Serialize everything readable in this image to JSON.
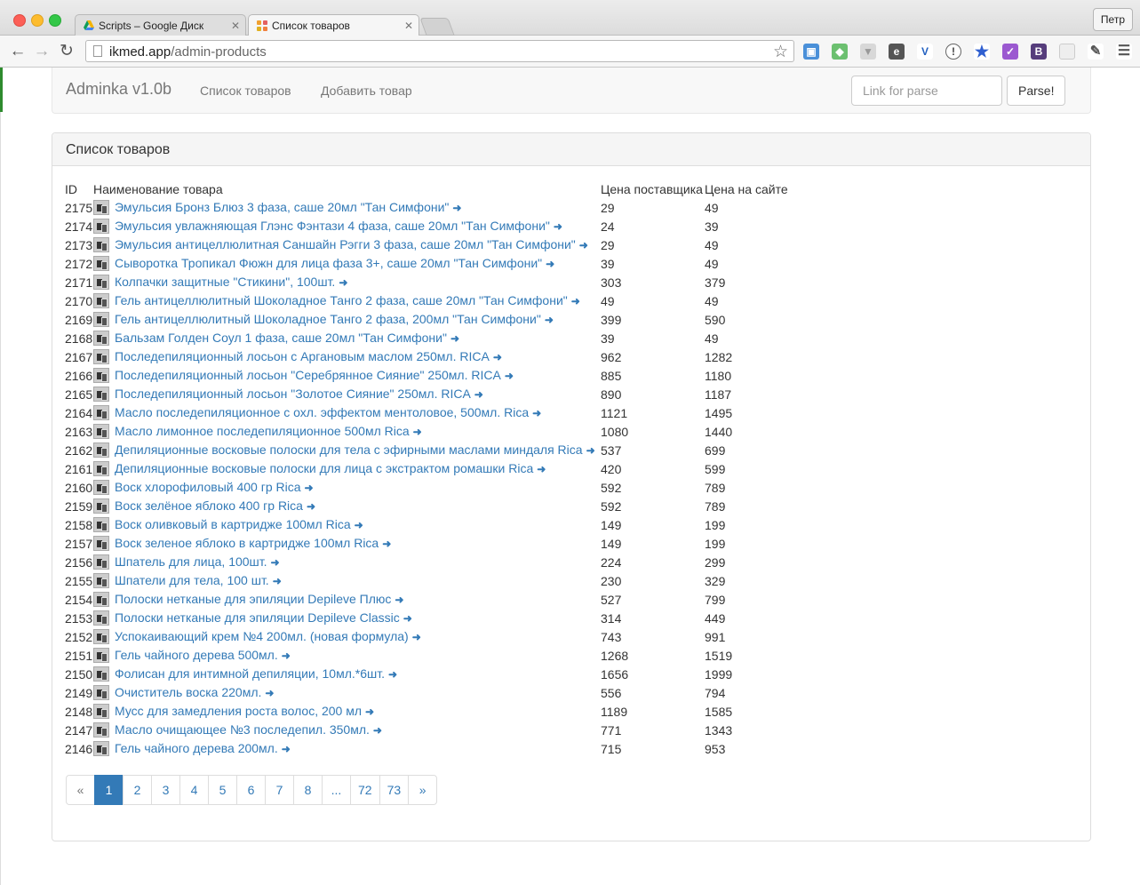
{
  "browser": {
    "tabs": [
      {
        "title": "Scripts – Google Диск"
      },
      {
        "title": "Список товаров"
      }
    ],
    "user_button": "Петр",
    "url_host": "ikmed.app",
    "url_path": "/admin-products"
  },
  "navbar": {
    "brand": "Adminka v1.0b",
    "links": [
      "Список товаров",
      "Добавить товар"
    ],
    "parse_placeholder": "Link for parse",
    "parse_button": "Parse!"
  },
  "panel": {
    "heading": "Список товаров",
    "columns": [
      "ID",
      "Наименование товара",
      "Цена поставщика",
      "Цена на сайте"
    ],
    "rows": [
      {
        "id": "2175",
        "name": "Эмульсия Бронз Блюз 3 фаза, саше 20мл \"Тан Симфони\"",
        "supplier_price": "29",
        "site_price": "49"
      },
      {
        "id": "2174",
        "name": "Эмульсия увлажняющая Глэнс Фэнтази 4 фаза, саше 20мл \"Тан Симфони\"",
        "supplier_price": "24",
        "site_price": "39"
      },
      {
        "id": "2173",
        "name": "Эмульсия антицеллюлитная Саншайн Рэгги 3 фаза, саше 20мл \"Тан Симфони\"",
        "supplier_price": "29",
        "site_price": "49"
      },
      {
        "id": "2172",
        "name": "Сыворотка Тропикал Фюжн для лица фаза 3+, саше 20мл \"Тан Симфони\"",
        "supplier_price": "39",
        "site_price": "49"
      },
      {
        "id": "2171",
        "name": "Колпачки защитные \"Стикини\", 100шт.",
        "supplier_price": "303",
        "site_price": "379"
      },
      {
        "id": "2170",
        "name": "Гель антицеллюлитный Шоколадное Танго 2 фаза, саше 20мл \"Тан Симфони\"",
        "supplier_price": "49",
        "site_price": "49"
      },
      {
        "id": "2169",
        "name": "Гель антицеллюлитный Шоколадное Танго 2 фаза, 200мл \"Тан Симфони\"",
        "supplier_price": "399",
        "site_price": "590"
      },
      {
        "id": "2168",
        "name": "Бальзам Голден Соул 1 фаза, саше 20мл \"Тан Симфони\"",
        "supplier_price": "39",
        "site_price": "49"
      },
      {
        "id": "2167",
        "name": "Последепиляционный лосьон с Аргановым маслом 250мл. RICA",
        "supplier_price": "962",
        "site_price": "1282"
      },
      {
        "id": "2166",
        "name": "Последепиляционный лосьон \"Серебрянное Сияние\" 250мл. RICA",
        "supplier_price": "885",
        "site_price": "1180"
      },
      {
        "id": "2165",
        "name": "Последепиляционный лосьон \"Золотое Сияние\" 250мл. RICA",
        "supplier_price": "890",
        "site_price": "1187"
      },
      {
        "id": "2164",
        "name": "Масло последепиляционное с охл. эффектом ментоловое, 500мл. Rica",
        "supplier_price": "1121",
        "site_price": "1495"
      },
      {
        "id": "2163",
        "name": "Масло лимонное последепиляционное 500мл Rica",
        "supplier_price": "1080",
        "site_price": "1440"
      },
      {
        "id": "2162",
        "name": "Депиляционные восковые полоски для тела с эфирными маслами миндаля Rica",
        "supplier_price": "537",
        "site_price": "699"
      },
      {
        "id": "2161",
        "name": "Депиляционные восковые полоски для лица с экстрактом ромашки Rica",
        "supplier_price": "420",
        "site_price": "599"
      },
      {
        "id": "2160",
        "name": "Воск хлорофиловый 400 гр Rica",
        "supplier_price": "592",
        "site_price": "789"
      },
      {
        "id": "2159",
        "name": "Воск зелёное яблоко 400 гр Rica",
        "supplier_price": "592",
        "site_price": "789"
      },
      {
        "id": "2158",
        "name": "Воск оливковый в картридже 100мл Rica",
        "supplier_price": "149",
        "site_price": "199"
      },
      {
        "id": "2157",
        "name": "Воск зеленое яблоко в картридже 100мл Rica",
        "supplier_price": "149",
        "site_price": "199"
      },
      {
        "id": "2156",
        "name": "Шпатель для лица, 100шт.",
        "supplier_price": "224",
        "site_price": "299"
      },
      {
        "id": "2155",
        "name": "Шпатели для тела, 100 шт.",
        "supplier_price": "230",
        "site_price": "329"
      },
      {
        "id": "2154",
        "name": "Полоски нетканые для эпиляции Depileve Плюс",
        "supplier_price": "527",
        "site_price": "799"
      },
      {
        "id": "2153",
        "name": "Полоски нетканые для эпиляции Depileve Classic",
        "supplier_price": "314",
        "site_price": "449"
      },
      {
        "id": "2152",
        "name": "Успокаивающий крем №4 200мл. (новая формула)",
        "supplier_price": "743",
        "site_price": "991"
      },
      {
        "id": "2151",
        "name": "Гель чайного дерева 500мл.",
        "supplier_price": "1268",
        "site_price": "1519"
      },
      {
        "id": "2150",
        "name": "Фолисан для интимной депиляции, 10мл.*6шт.",
        "supplier_price": "1656",
        "site_price": "1999"
      },
      {
        "id": "2149",
        "name": "Очиститель воска 220мл.",
        "supplier_price": "556",
        "site_price": "794"
      },
      {
        "id": "2148",
        "name": "Мусс для замедления роста волос, 200 мл",
        "supplier_price": "1189",
        "site_price": "1585"
      },
      {
        "id": "2147",
        "name": "Масло очищающее №3 последепил. 350мл.",
        "supplier_price": "771",
        "site_price": "1343"
      },
      {
        "id": "2146",
        "name": "Гель чайного дерева 200мл.",
        "supplier_price": "715",
        "site_price": "953"
      }
    ]
  },
  "pagination": {
    "items": [
      "«",
      "1",
      "2",
      "3",
      "4",
      "5",
      "6",
      "7",
      "8",
      "...",
      "72",
      "73",
      "»"
    ],
    "active": "1"
  },
  "colors": {
    "link": "#337ab7",
    "active_page": "#337ab7"
  }
}
